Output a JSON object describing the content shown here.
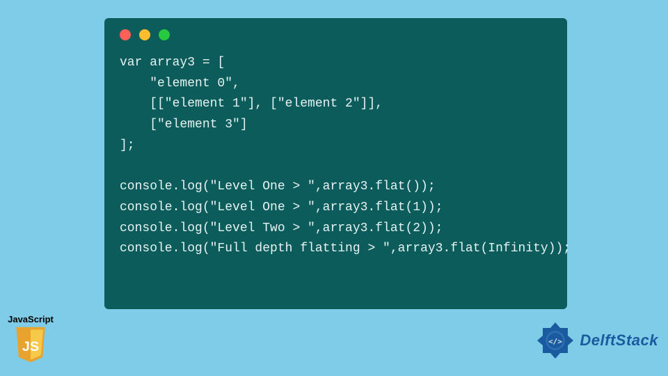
{
  "code_lines": [
    "var array3 = [",
    "    \"element 0\",",
    "    [[\"element 1\"], [\"element 2\"]],",
    "    [\"element 3\"]",
    "];",
    "",
    "console.log(\"Level One > \",array3.flat());",
    "console.log(\"Level One > \",array3.flat(1));",
    "console.log(\"Level Two > \",array3.flat(2));",
    "console.log(\"Full depth flatting > \",array3.flat(Infinity));"
  ],
  "badges": {
    "js_label": "JavaScript",
    "delft_text": "DelftStack"
  },
  "colors": {
    "page_bg": "#7ecce8",
    "card_bg": "#0d5c5c",
    "js_yellow": "#f7df1e",
    "delft_blue": "#1a5a9e"
  }
}
